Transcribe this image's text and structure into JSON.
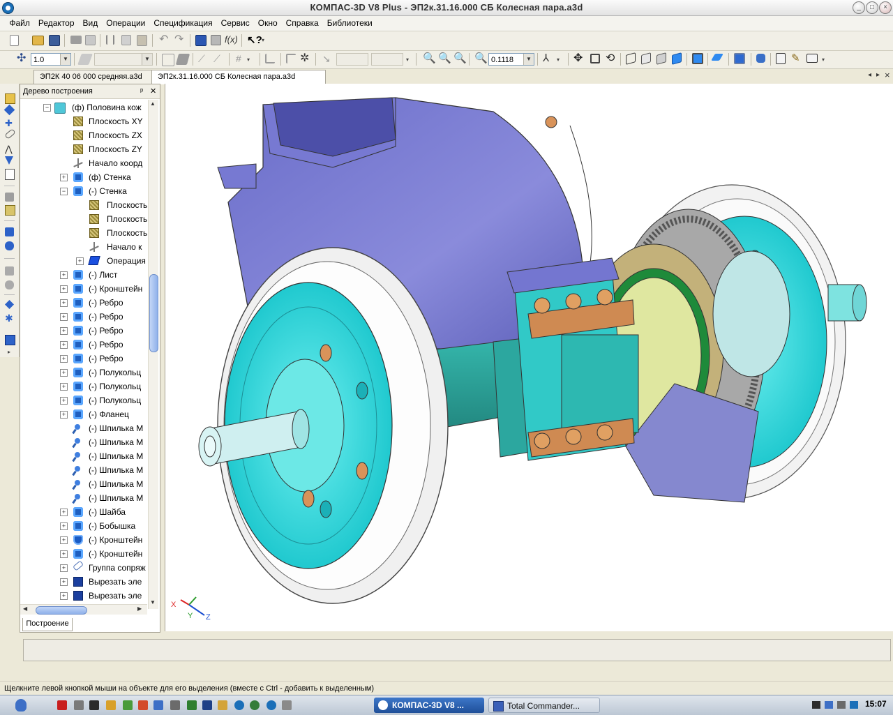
{
  "window": {
    "title": "КОМПАС-3D V8 Plus - ЭП2к.31.16.000 СБ Колесная пара.a3d",
    "minimize": "_",
    "maximize": "□",
    "close": "×"
  },
  "menu": [
    "Файл",
    "Редактор",
    "Вид",
    "Операции",
    "Спецификация",
    "Сервис",
    "Окно",
    "Справка",
    "Библиотеки"
  ],
  "toolbar": {
    "step_value": "1.0",
    "zoom_value": "0.1118"
  },
  "tabs": [
    {
      "label": "ЭП2К 40 06 000 средняя.a3d",
      "active": false
    },
    {
      "label": "ЭП2к.31.16.000 СБ Колесная пара.a3d",
      "active": true
    }
  ],
  "tree": {
    "title": "Дерево построения",
    "pin": "ᵖ",
    "close": "✕",
    "bottom_tab": "Построение",
    "items": [
      {
        "label": "(ф) Половина кож",
        "exp": "−",
        "icon": "root",
        "level": 0
      },
      {
        "label": "Плоскость XY",
        "exp": "",
        "icon": "plane",
        "level": 1
      },
      {
        "label": "Плоскость ZX",
        "exp": "",
        "icon": "plane",
        "level": 1
      },
      {
        "label": "Плоскость ZY",
        "exp": "",
        "icon": "plane",
        "level": 1
      },
      {
        "label": "Начало коорд",
        "exp": "",
        "icon": "origin",
        "level": 1
      },
      {
        "label": "(ф) Стенка",
        "exp": "+",
        "icon": "op",
        "level": 1
      },
      {
        "label": "(-) Стенка",
        "exp": "−",
        "icon": "op",
        "level": 1
      },
      {
        "label": "Плоскость",
        "exp": "",
        "icon": "plane",
        "level": 2
      },
      {
        "label": "Плоскость",
        "exp": "",
        "icon": "plane",
        "level": 2
      },
      {
        "label": "Плоскость",
        "exp": "",
        "icon": "plane",
        "level": 2
      },
      {
        "label": "Начало к",
        "exp": "",
        "icon": "origin",
        "level": 2
      },
      {
        "label": "Операция",
        "exp": "+",
        "icon": "cube",
        "level": 2
      },
      {
        "label": "(-) Лист",
        "exp": "+",
        "icon": "op",
        "level": 1
      },
      {
        "label": "(-) Кронштейн",
        "exp": "+",
        "icon": "op",
        "level": 1
      },
      {
        "label": "(-) Ребро",
        "exp": "+",
        "icon": "op",
        "level": 1
      },
      {
        "label": "(-) Ребро",
        "exp": "+",
        "icon": "op",
        "level": 1
      },
      {
        "label": "(-) Ребро",
        "exp": "+",
        "icon": "op",
        "level": 1
      },
      {
        "label": "(-) Ребро",
        "exp": "+",
        "icon": "op",
        "level": 1
      },
      {
        "label": "(-) Ребро",
        "exp": "+",
        "icon": "op",
        "level": 1
      },
      {
        "label": "(-) Полукольц",
        "exp": "+",
        "icon": "op",
        "level": 1
      },
      {
        "label": "(-) Полукольц",
        "exp": "+",
        "icon": "op",
        "level": 1
      },
      {
        "label": "(-) Полукольц",
        "exp": "+",
        "icon": "op",
        "level": 1
      },
      {
        "label": "(-) Фланец",
        "exp": "+",
        "icon": "op",
        "level": 1
      },
      {
        "label": "(-) Шпилька М",
        "exp": "",
        "icon": "pin",
        "level": 1
      },
      {
        "label": "(-) Шпилька М",
        "exp": "",
        "icon": "pin",
        "level": 1
      },
      {
        "label": "(-) Шпилька М",
        "exp": "",
        "icon": "pin",
        "level": 1
      },
      {
        "label": "(-) Шпилька М",
        "exp": "",
        "icon": "pin",
        "level": 1
      },
      {
        "label": "(-) Шпилька М",
        "exp": "",
        "icon": "pin",
        "level": 1
      },
      {
        "label": "(-) Шпилька М",
        "exp": "",
        "icon": "pin",
        "level": 1
      },
      {
        "label": "(-) Шайба",
        "exp": "+",
        "icon": "op",
        "level": 1
      },
      {
        "label": "(-) Бобышка",
        "exp": "+",
        "icon": "op",
        "level": 1
      },
      {
        "label": "(-) Кронштейн",
        "exp": "+",
        "icon": "shield",
        "level": 1
      },
      {
        "label": "(-) Кронштейн",
        "exp": "+",
        "icon": "op",
        "level": 1
      },
      {
        "label": "Группа сопряж",
        "exp": "+",
        "icon": "group",
        "level": 1
      },
      {
        "label": "Вырезать эле",
        "exp": "+",
        "icon": "cut",
        "level": 1
      },
      {
        "label": "Вырезать эле",
        "exp": "+",
        "icon": "cut",
        "level": 1
      }
    ]
  },
  "axes": {
    "x": "X",
    "y": "Y",
    "z": "Z"
  },
  "status_text": "Щелкните левой кнопкой мыши на объекте для его выделения (вместе с Ctrl - добавить к выделенным)",
  "taskbar": {
    "tasks": [
      {
        "label": "КОМПАС-3D V8 ...",
        "active": true
      },
      {
        "label": "Total Commander...",
        "active": false
      }
    ],
    "clock": "15:07"
  },
  "colors": {
    "casing": "#8587d6",
    "wheel_disk": "#33dede",
    "axle": "#2b9e95",
    "gear": "#6f6f6f",
    "bolt": "#d9935a"
  }
}
